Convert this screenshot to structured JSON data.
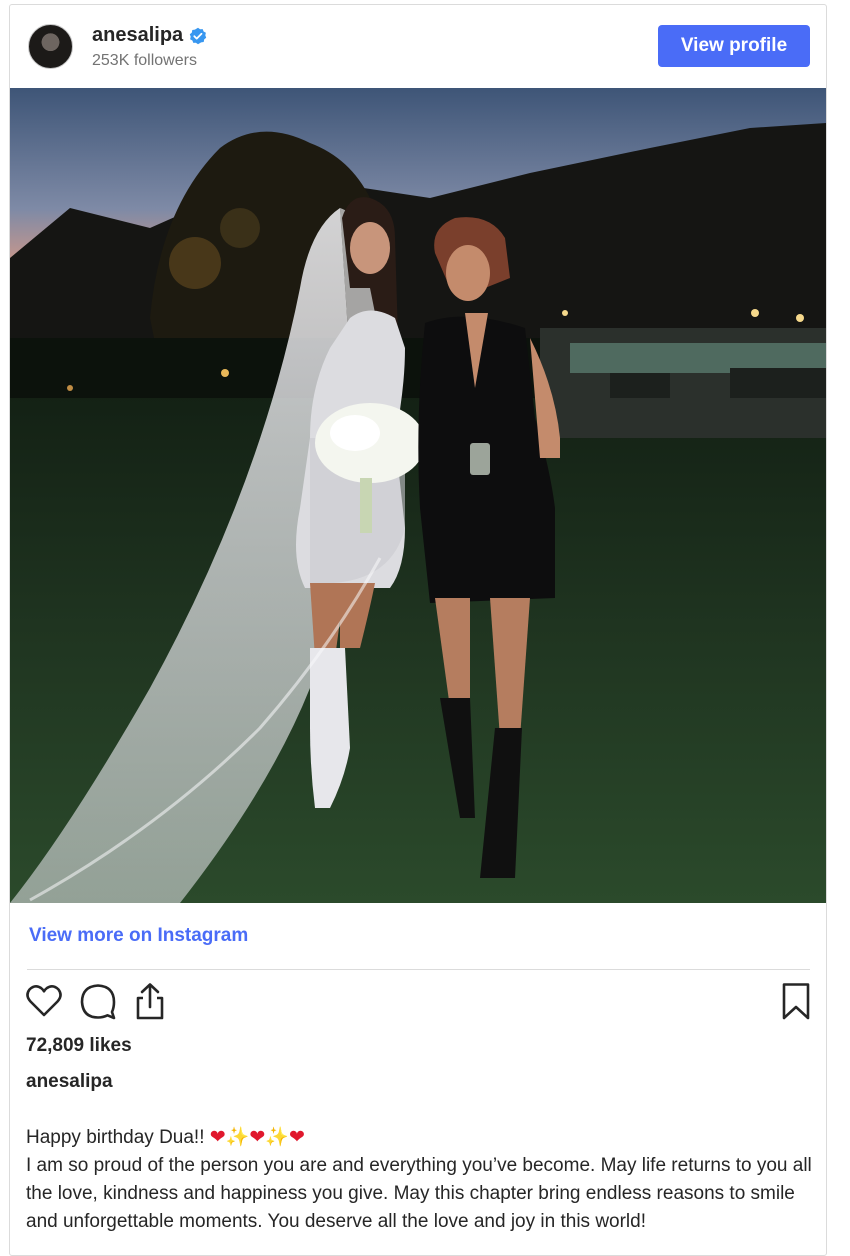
{
  "header": {
    "username": "anesalipa",
    "followers": "253K followers",
    "view_profile_label": "View profile"
  },
  "post": {
    "image_alt": "Photo posted by anesalipa",
    "view_more_label": "View more on Instagram",
    "likes": "72,809 likes",
    "caption_username": "anesalipa",
    "caption_first_line": "Happy birthday Dua!!",
    "caption_emojis": [
      "❤",
      "✨",
      "❤",
      "✨",
      "❤"
    ],
    "caption_body": "I am so proud of the person you are and everything you’ve become. May life returns to you all the love, kindness and happiness you give. May this chapter bring endless reasons to smile and unforgettable moments. You deserve all the love and joy in this world!"
  },
  "icons": {
    "verified": "verified-badge-icon",
    "like": "heart-icon",
    "comment": "comment-icon",
    "share": "share-icon",
    "save": "bookmark-icon"
  },
  "colors": {
    "accent": "#4a6cf7",
    "verified": "#3897f0",
    "heart": "#e0182d"
  }
}
